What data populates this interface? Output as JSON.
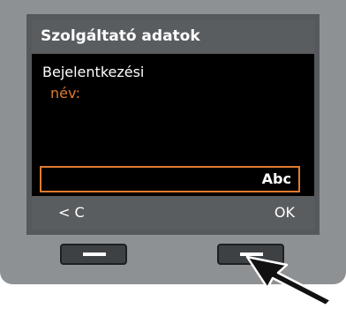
{
  "screen": {
    "title": "Szolgáltató adatok",
    "prompt_line1": "Bejelentkezési",
    "prompt_line2": "név:",
    "input_mode": "Abc"
  },
  "softkeys": {
    "left_label": "< C",
    "right_label": "OK"
  },
  "colors": {
    "accent": "#e07a2e",
    "bar": "#5a5d60",
    "device": "#8e9194"
  },
  "icons": {
    "pointer": "arrow-icon"
  }
}
